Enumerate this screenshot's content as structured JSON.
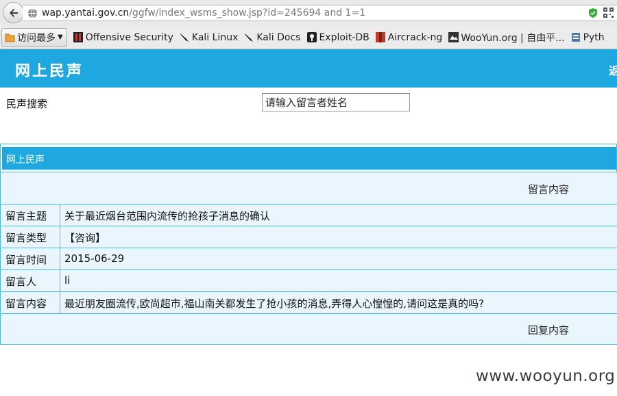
{
  "browser": {
    "url_domain": "wap.yantai.gov.cn",
    "url_rest": "/ggfw/index_wsms_show.jsp?id=245694 and 1=1",
    "bookmarks": {
      "most_visited": "访问最多",
      "items": [
        "Offensive Security",
        "Kali Linux",
        "Kali Docs",
        "Exploit-DB",
        "Aircrack-ng",
        "WooYun.org | 自由平...",
        "Pyth"
      ]
    }
  },
  "header": {
    "title": "网上民声",
    "back_label": "返"
  },
  "search": {
    "label": "民声搜索",
    "placeholder": "请输入留言者姓名"
  },
  "section": {
    "title": "网上民声",
    "content_header": "留言内容",
    "reply_header": "回复内容",
    "rows": [
      {
        "key": "留言主题",
        "value": "关于最近烟台范围内流传的抢孩子消息的确认"
      },
      {
        "key": "留言类型",
        "value": "【咨询】"
      },
      {
        "key": "留言时间",
        "value": "2015-06-29"
      },
      {
        "key": "留言人",
        "value": "li"
      },
      {
        "key": "留言内容",
        "value": "最近朋友圈流传,欧尚超市,福山南关都发生了抢小孩的消息,弄得人心惶惶的,请问这是真的吗?"
      }
    ]
  },
  "watermark": "www.wooyun.org",
  "colors": {
    "accent": "#1fa7e0",
    "row_bg": "#eaf6fd",
    "border": "#45b9de"
  }
}
